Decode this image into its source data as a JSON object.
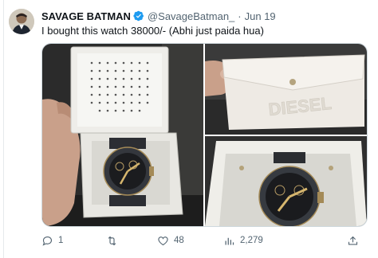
{
  "tweet": {
    "author_name": "SAVAGE BATMAN",
    "author_handle": "@SavageBatman_",
    "separator": "·",
    "date": "Jun 19",
    "text": "I bought this watch 38000/- (Abhi just paida hua)",
    "verified_icon": "verified-badge-icon",
    "verified_color": "#1d9bf0"
  },
  "media": {
    "images": [
      {
        "subject": "watch-box-open-in-hand"
      },
      {
        "subject": "diesel-pouch"
      },
      {
        "subject": "watch-in-box-closeup"
      }
    ],
    "pouch_brand": "DIESEL"
  },
  "actions": {
    "reply": {
      "icon": "reply-icon",
      "count": "1"
    },
    "retweet": {
      "icon": "retweet-icon",
      "count": ""
    },
    "like": {
      "icon": "heart-icon",
      "count": "48"
    },
    "views": {
      "icon": "views-chart-icon",
      "count": "2,279"
    },
    "share": {
      "icon": "share-icon"
    }
  },
  "colors": {
    "text_primary": "#0f1419",
    "text_secondary": "#536471",
    "border": "#cfd9de",
    "accent": "#1d9bf0"
  }
}
